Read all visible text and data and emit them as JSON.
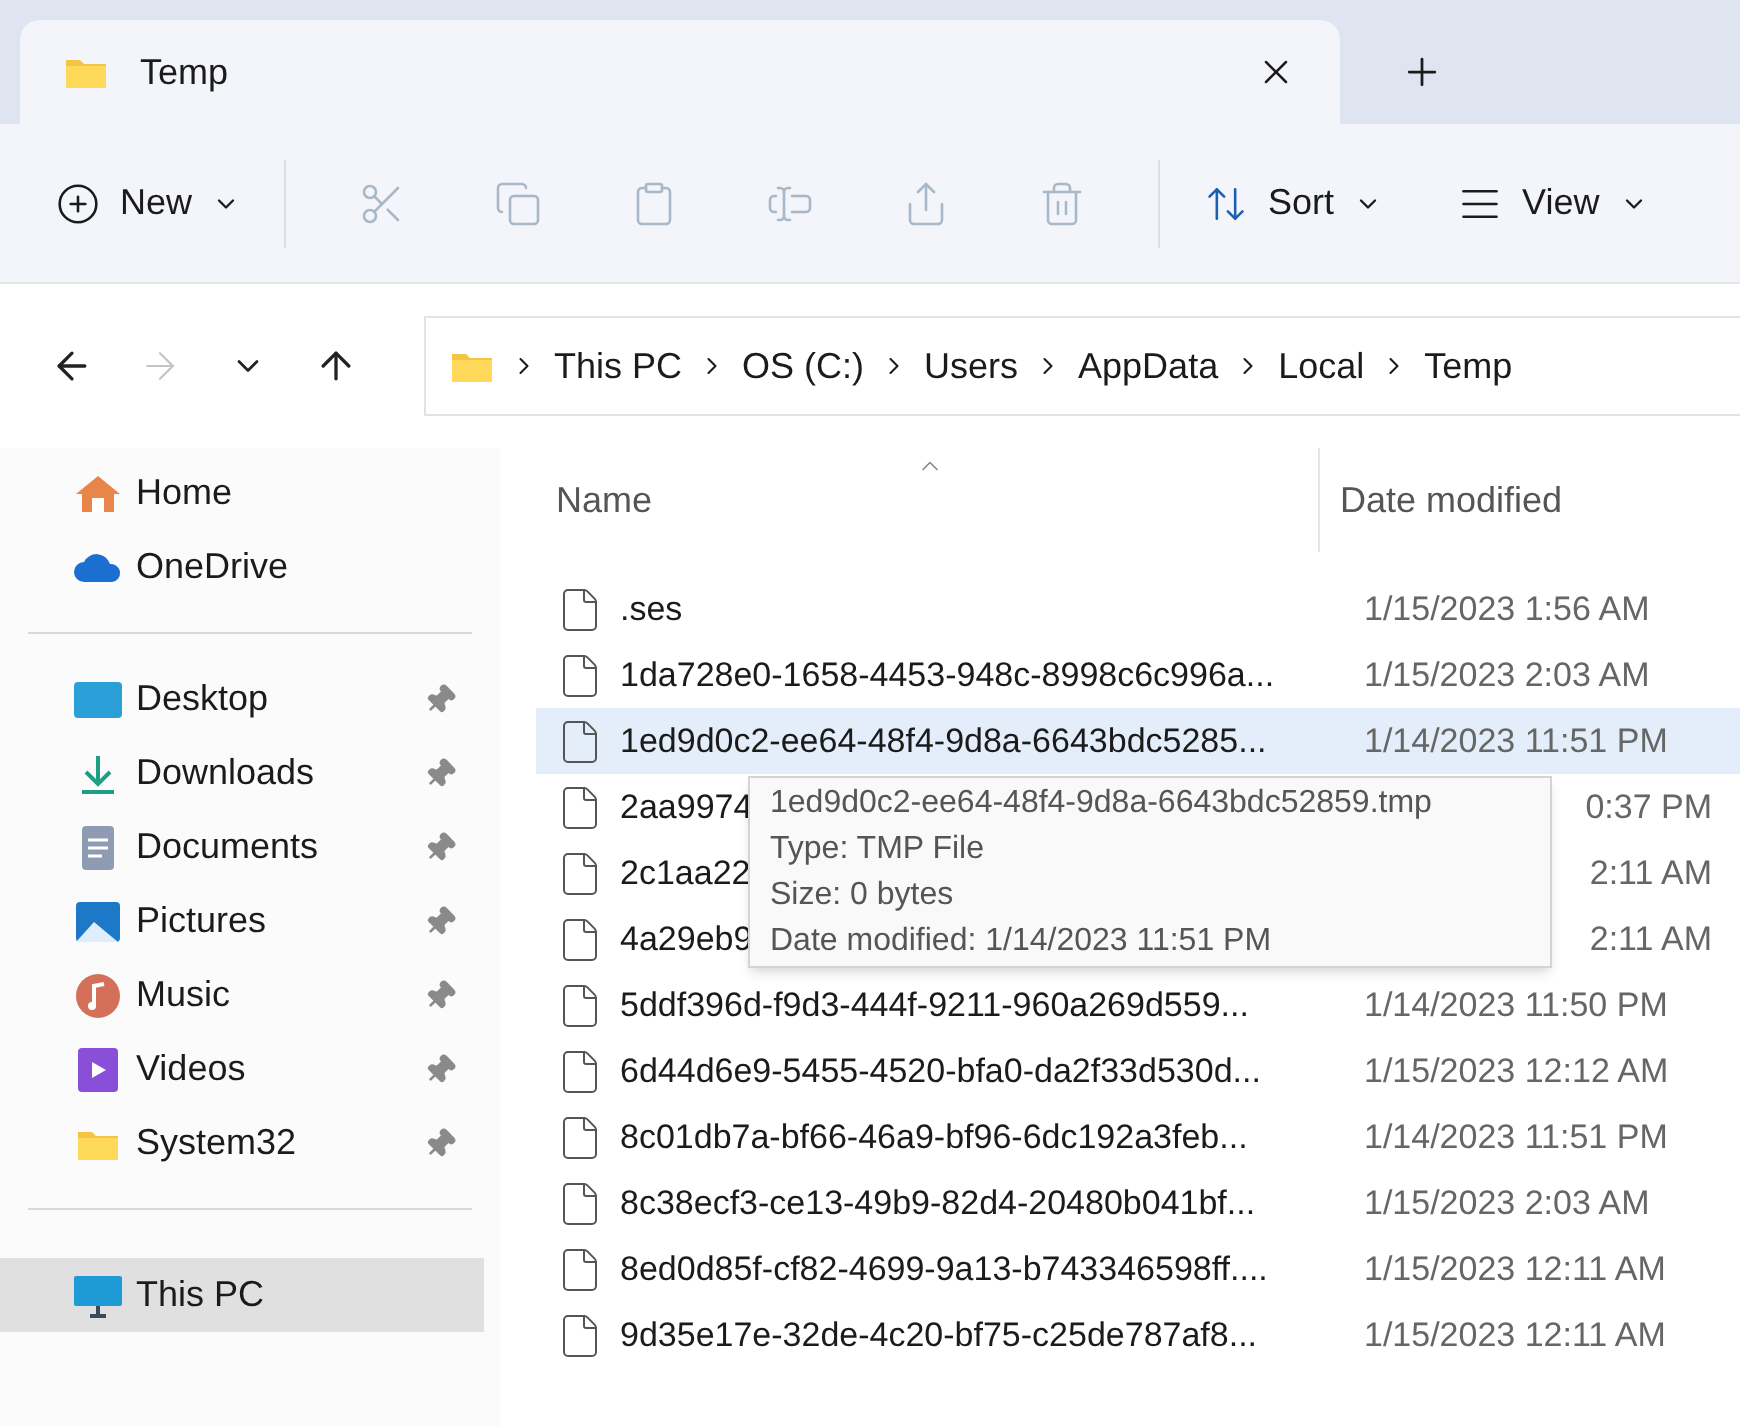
{
  "tabs": [
    {
      "label": "Temp",
      "selected": true
    }
  ],
  "toolbar": {
    "new": {
      "label": "New"
    },
    "actions": [
      {
        "disabled": true
      },
      {
        "disabled": true
      },
      {
        "disabled": true
      },
      {
        "disabled": true
      },
      {
        "disabled": true
      },
      {
        "disabled": true
      }
    ],
    "sort": {
      "label": "Sort"
    },
    "view": {
      "label": "View"
    }
  },
  "nav": [
    {
      "disabled": false
    },
    {
      "disabled": true
    },
    {
      "disabled": false
    },
    {
      "disabled": false
    }
  ],
  "breadcrumb": [
    "This PC",
    "OS (C:)",
    "Users",
    "AppData",
    "Local",
    "Temp"
  ],
  "sidebar": {
    "groups": [
      {
        "items": [
          {
            "label": "Home",
            "pinned": false,
            "selected": false
          },
          {
            "label": "OneDrive",
            "pinned": false,
            "selected": false
          }
        ]
      },
      {
        "items": [
          {
            "label": "Desktop",
            "pinned": true,
            "selected": false
          },
          {
            "label": "Downloads",
            "pinned": true,
            "selected": false
          },
          {
            "label": "Documents",
            "pinned": true,
            "selected": false
          },
          {
            "label": "Pictures",
            "pinned": true,
            "selected": false
          },
          {
            "label": "Music",
            "pinned": true,
            "selected": false
          },
          {
            "label": "Videos",
            "pinned": true,
            "selected": false
          },
          {
            "label": "System32",
            "pinned": true,
            "selected": false
          }
        ]
      },
      {
        "items": [
          {
            "label": "This PC",
            "pinned": false,
            "selected": true
          }
        ]
      }
    ]
  },
  "table": {
    "columns": [
      "Name",
      "Date modified"
    ],
    "rows": [
      {
        "kind": "file",
        "name": ".ses",
        "date": "1/15/2023 1:56 AM",
        "selected": false
      },
      {
        "kind": "file",
        "name": "1da728e0-1658-4453-948c-8998c6c996a...",
        "date": "1/15/2023 2:03 AM",
        "selected": false
      },
      {
        "kind": "file",
        "name": "1ed9d0c2-ee64-48f4-9d8a-6643bdc5285...",
        "date": "1/14/2023 11:51 PM",
        "selected": true
      },
      {
        "kind": "partial",
        "name": "2aa9974",
        "date": "0:37 PM",
        "selected": false
      },
      {
        "kind": "partial",
        "name": "2c1aa22",
        "date": "2:11 AM",
        "selected": false
      },
      {
        "kind": "partial",
        "name": "4a29eb9",
        "date": "2:11 AM",
        "selected": false
      },
      {
        "kind": "file",
        "name": "5ddf396d-f9d3-444f-9211-960a269d559...",
        "date": "1/14/2023 11:50 PM",
        "selected": false
      },
      {
        "kind": "file",
        "name": "6d44d6e9-5455-4520-bfa0-da2f33d530d...",
        "date": "1/15/2023 12:12 AM",
        "selected": false
      },
      {
        "kind": "file",
        "name": "8c01db7a-bf66-46a9-bf96-6dc192a3feb...",
        "date": "1/14/2023 11:51 PM",
        "selected": false
      },
      {
        "kind": "file",
        "name": "8c38ecf3-ce13-49b9-82d4-20480b041bf...",
        "date": "1/15/2023 2:03 AM",
        "selected": false
      },
      {
        "kind": "file",
        "name": "8ed0d85f-cf82-4699-9a13-b743346598ff....",
        "date": "1/15/2023 12:11 AM",
        "selected": false
      },
      {
        "kind": "file",
        "name": "9d35e17e-32de-4c20-bf75-c25de787af8...",
        "date": "1/15/2023 12:11 AM",
        "selected": false
      }
    ]
  },
  "tooltip": [
    "1ed9d0c2-ee64-48f4-9d8a-6643bdc52859.tmp",
    "Type: TMP File",
    "Size: 0 bytes",
    "Date modified: 1/14/2023 11:51 PM"
  ]
}
